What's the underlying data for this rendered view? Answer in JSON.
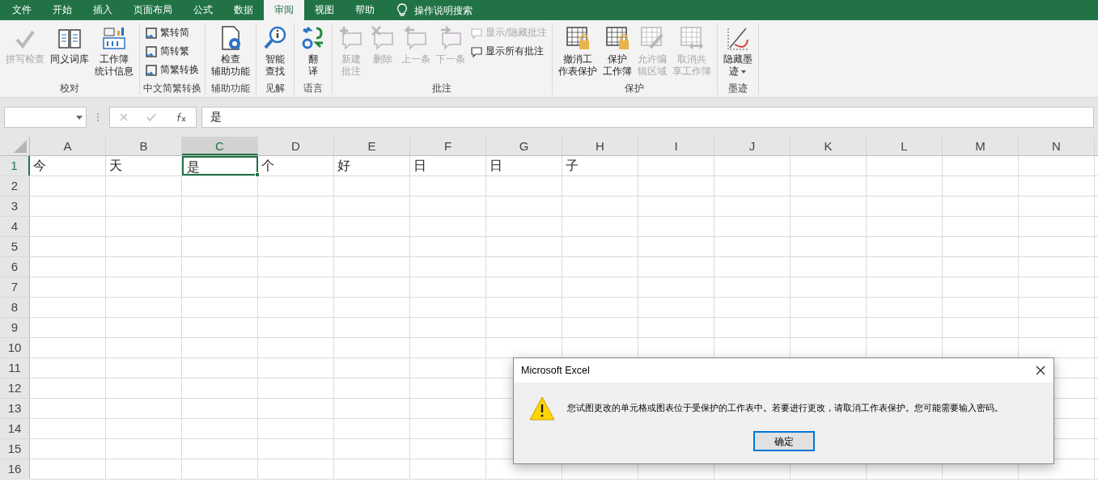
{
  "menu_tabs": [
    {
      "label": "文件",
      "selected": false
    },
    {
      "label": "开始",
      "selected": false
    },
    {
      "label": "插入",
      "selected": false
    },
    {
      "label": "页面布局",
      "selected": false
    },
    {
      "label": "公式",
      "selected": false
    },
    {
      "label": "数据",
      "selected": false
    },
    {
      "label": "审阅",
      "selected": true
    },
    {
      "label": "视图",
      "selected": false
    },
    {
      "label": "帮助",
      "selected": false
    }
  ],
  "tell_me": {
    "placeholder": "操作说明搜索"
  },
  "ribbon_groups": [
    {
      "label": "校对",
      "items": [
        {
          "kind": "large",
          "lines": [
            "拼写检查"
          ],
          "disabled": true
        },
        {
          "kind": "large",
          "lines": [
            "同义词库"
          ],
          "disabled": false
        },
        {
          "kind": "large",
          "lines": [
            "工作簿",
            "统计信息"
          ],
          "disabled": false
        }
      ]
    },
    {
      "label": "中文简繁转换",
      "items": [
        {
          "kind": "small",
          "lines": [
            "繁转简"
          ],
          "disabled": false
        },
        {
          "kind": "small",
          "lines": [
            "简转繁"
          ],
          "disabled": false
        },
        {
          "kind": "small",
          "lines": [
            "简繁转换"
          ],
          "disabled": false
        }
      ]
    },
    {
      "label": "辅助功能",
      "items": [
        {
          "kind": "large",
          "lines": [
            "检查",
            "辅助功能"
          ],
          "disabled": false
        }
      ]
    },
    {
      "label": "见解",
      "items": [
        {
          "kind": "large",
          "lines": [
            "智能",
            "查找"
          ],
          "disabled": false
        }
      ]
    },
    {
      "label": "语言",
      "items": [
        {
          "kind": "large",
          "lines": [
            "翻",
            "译"
          ],
          "disabled": false
        }
      ]
    },
    {
      "label": "批注",
      "items": [
        {
          "kind": "large",
          "lines": [
            "新建",
            "批注"
          ],
          "disabled": true
        },
        {
          "kind": "large",
          "lines": [
            "删除"
          ],
          "disabled": true
        },
        {
          "kind": "large",
          "lines": [
            "上一条"
          ],
          "disabled": true
        },
        {
          "kind": "large",
          "lines": [
            "下一条"
          ],
          "disabled": true
        },
        {
          "kind": "small",
          "lines": [
            "显示/隐藏批注"
          ],
          "disabled": true
        },
        {
          "kind": "small",
          "lines": [
            "显示所有批注"
          ],
          "disabled": false
        }
      ]
    },
    {
      "label": "保护",
      "items": [
        {
          "kind": "large",
          "lines": [
            "撤消工",
            "作表保护"
          ],
          "disabled": false
        },
        {
          "kind": "large",
          "lines": [
            "保护",
            "工作簿"
          ],
          "disabled": false
        },
        {
          "kind": "large",
          "lines": [
            "允许编",
            "辑区域"
          ],
          "disabled": true
        },
        {
          "kind": "large",
          "lines": [
            "取消共",
            "享工作簿"
          ],
          "disabled": true
        }
      ]
    },
    {
      "label": "墨迹",
      "items": [
        {
          "kind": "large",
          "lines": [
            "隐藏墨",
            "迹"
          ],
          "disabled": false,
          "dropdown": true
        }
      ]
    }
  ],
  "formula_bar": {
    "value": "是"
  },
  "columns": [
    {
      "label": "A",
      "selected": false
    },
    {
      "label": "B",
      "selected": false
    },
    {
      "label": "C",
      "selected": true
    },
    {
      "label": "D",
      "selected": false
    },
    {
      "label": "E",
      "selected": false
    },
    {
      "label": "F",
      "selected": false
    },
    {
      "label": "G",
      "selected": false
    },
    {
      "label": "H",
      "selected": false
    },
    {
      "label": "I",
      "selected": false
    },
    {
      "label": "J",
      "selected": false
    },
    {
      "label": "K",
      "selected": false
    },
    {
      "label": "L",
      "selected": false
    },
    {
      "label": "M",
      "selected": false
    },
    {
      "label": "N",
      "selected": false
    }
  ],
  "rows": [
    {
      "label": "1",
      "selected": true,
      "cells": [
        {
          "value": "今",
          "selected": false
        },
        {
          "value": "天",
          "selected": false
        },
        {
          "value": "是",
          "selected": true
        },
        {
          "value": "个",
          "selected": false
        },
        {
          "value": "好",
          "selected": false
        },
        {
          "value": "日",
          "selected": false
        },
        {
          "value": "日",
          "selected": false
        },
        {
          "value": "子",
          "selected": false
        }
      ]
    },
    {
      "label": "2",
      "selected": false,
      "cells": []
    },
    {
      "label": "3",
      "selected": false,
      "cells": []
    },
    {
      "label": "4",
      "selected": false,
      "cells": []
    },
    {
      "label": "5",
      "selected": false,
      "cells": []
    },
    {
      "label": "6",
      "selected": false,
      "cells": []
    },
    {
      "label": "7",
      "selected": false,
      "cells": []
    },
    {
      "label": "8",
      "selected": false,
      "cells": []
    },
    {
      "label": "9",
      "selected": false,
      "cells": []
    },
    {
      "label": "10",
      "selected": false,
      "cells": []
    },
    {
      "label": "11",
      "selected": false,
      "cells": []
    },
    {
      "label": "12",
      "selected": false,
      "cells": []
    },
    {
      "label": "13",
      "selected": false,
      "cells": []
    },
    {
      "label": "14",
      "selected": false,
      "cells": []
    },
    {
      "label": "15",
      "selected": false,
      "cells": []
    },
    {
      "label": "16",
      "selected": false,
      "cells": []
    }
  ],
  "dialog": {
    "title": "Microsoft Excel",
    "message": "您试图更改的单元格或图表位于受保护的工作表中。若要进行更改，请取消工作表保护。您可能需要输入密码。",
    "buttons": [
      "确定"
    ]
  }
}
